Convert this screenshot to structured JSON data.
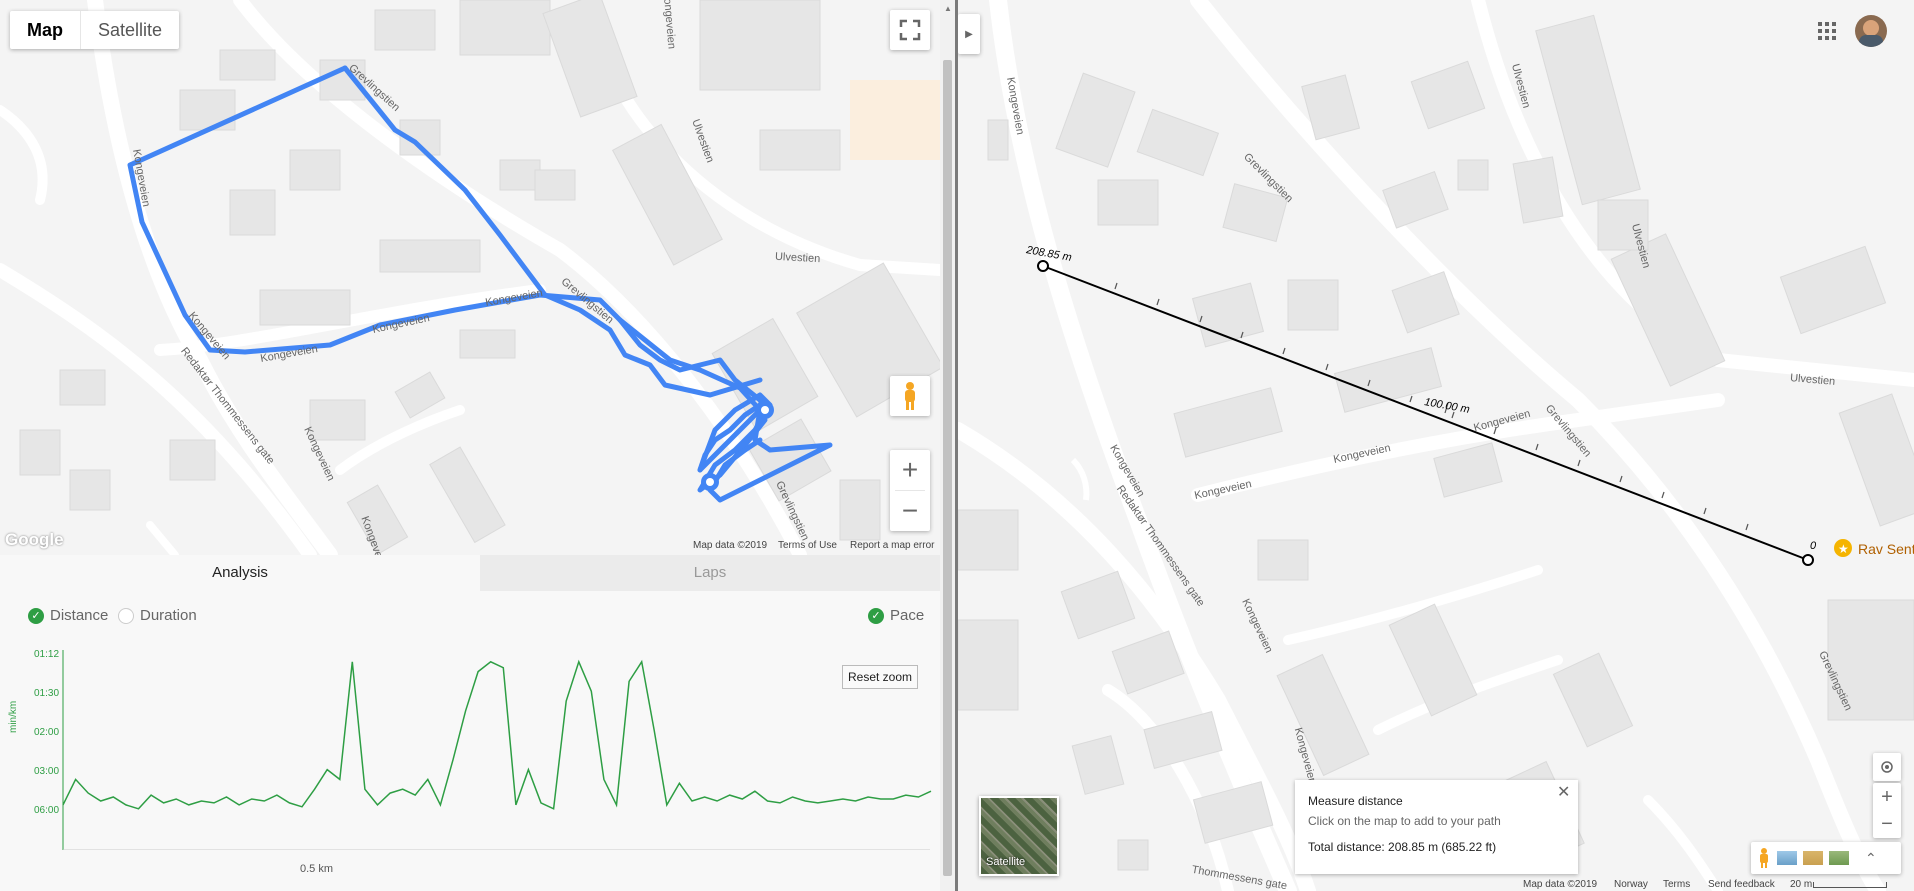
{
  "left_map": {
    "map_type": {
      "map": "Map",
      "satellite": "Satellite"
    },
    "street_labels": [
      {
        "name": "Grevlingstien"
      },
      {
        "name": "Ulvestien"
      },
      {
        "name": "Ulvestien"
      },
      {
        "name": "Kongeveien"
      },
      {
        "name": "Grevlingstien"
      },
      {
        "name": "Kongeveien"
      },
      {
        "name": "Kongeveien"
      },
      {
        "name": "Kongeveien"
      },
      {
        "name": "Kongeveien"
      },
      {
        "name": "Kongeveien"
      },
      {
        "name": "Redaktør Thommessens gate"
      },
      {
        "name": "Kongeveien"
      },
      {
        "name": "Grevlingstien"
      },
      {
        "name": "Kongeveien"
      }
    ],
    "google_logo": "Google",
    "attribution": {
      "map_data": "Map data ©2019",
      "terms": "Terms of Use",
      "report": "Report a map error"
    },
    "zoom_in": "+",
    "zoom_out": "−",
    "route_color": "#4285f4"
  },
  "analysis": {
    "tabs": {
      "analysis": "Analysis",
      "laps": "Laps"
    },
    "legend": {
      "distance": "Distance",
      "duration": "Duration",
      "pace": "Pace"
    },
    "reset_zoom": "Reset zoom",
    "y_axis_label": "min/km",
    "y_ticks": [
      "01:12",
      "01:30",
      "02:00",
      "03:00",
      "06:00"
    ],
    "x_tick": "0.5 km",
    "line_color": "#2e9e44"
  },
  "chart_data": {
    "type": "line",
    "title": "",
    "xlabel": "",
    "ylabel": "min/km",
    "y_ticks": [
      "01:12",
      "01:30",
      "02:00",
      "03:00",
      "06:00"
    ],
    "x_ticks": [
      "0.5 km"
    ],
    "series": [
      {
        "values": [
          0.22,
          0.35,
          0.28,
          0.24,
          0.26,
          0.22,
          0.2,
          0.27,
          0.23,
          0.25,
          0.22,
          0.24,
          0.23,
          0.26,
          0.22,
          0.25,
          0.24,
          0.27,
          0.23,
          0.21,
          0.3,
          0.4,
          0.35,
          0.95,
          0.3,
          0.22,
          0.28,
          0.3,
          0.27,
          0.35,
          0.22,
          0.45,
          0.7,
          0.9,
          0.95,
          0.92,
          0.22,
          0.4,
          0.23,
          0.2,
          0.75,
          0.95,
          0.8,
          0.35,
          0.22,
          0.85,
          0.95,
          0.6,
          0.22,
          0.33,
          0.24,
          0.26,
          0.24,
          0.27,
          0.25,
          0.29,
          0.24,
          0.23,
          0.26,
          0.24,
          0.23,
          0.24,
          0.25,
          0.24,
          0.26,
          0.25,
          0.25,
          0.27,
          0.26,
          0.29
        ]
      }
    ]
  },
  "right_map": {
    "street_labels": [
      {
        "name": "Kongeveien"
      },
      {
        "name": "Grevlingstien"
      },
      {
        "name": "Ulvestien"
      },
      {
        "name": "Ulvestien"
      },
      {
        "name": "Ulvestien"
      },
      {
        "name": "Grevlingstien"
      },
      {
        "name": "Kongeveien"
      },
      {
        "name": "Kongeveien"
      },
      {
        "name": "Kongeveien"
      },
      {
        "name": "Kongeveien"
      },
      {
        "name": "Redaktør Thommessens gate"
      },
      {
        "name": "Kongeveien"
      },
      {
        "name": "Grevlingstien"
      },
      {
        "name": "Kongeveien"
      },
      {
        "name": "Thommessens gate"
      }
    ],
    "measure_start_label": "208.85 m",
    "measure_mid_label": "100.00 m",
    "measure_end_label": "0",
    "poi": "Rav Sentr",
    "satellite_thumb": "Satellite",
    "measure_box": {
      "title": "Measure distance",
      "hint": "Click on the map to add to your path",
      "total": "Total distance: 208.85 m (685.22 ft)"
    },
    "attribution": {
      "map_data": "Map data ©2019",
      "country": "Norway",
      "terms": "Terms",
      "feedback": "Send feedback",
      "scale": "20 m"
    },
    "zoom_in": "+",
    "zoom_out": "−"
  }
}
